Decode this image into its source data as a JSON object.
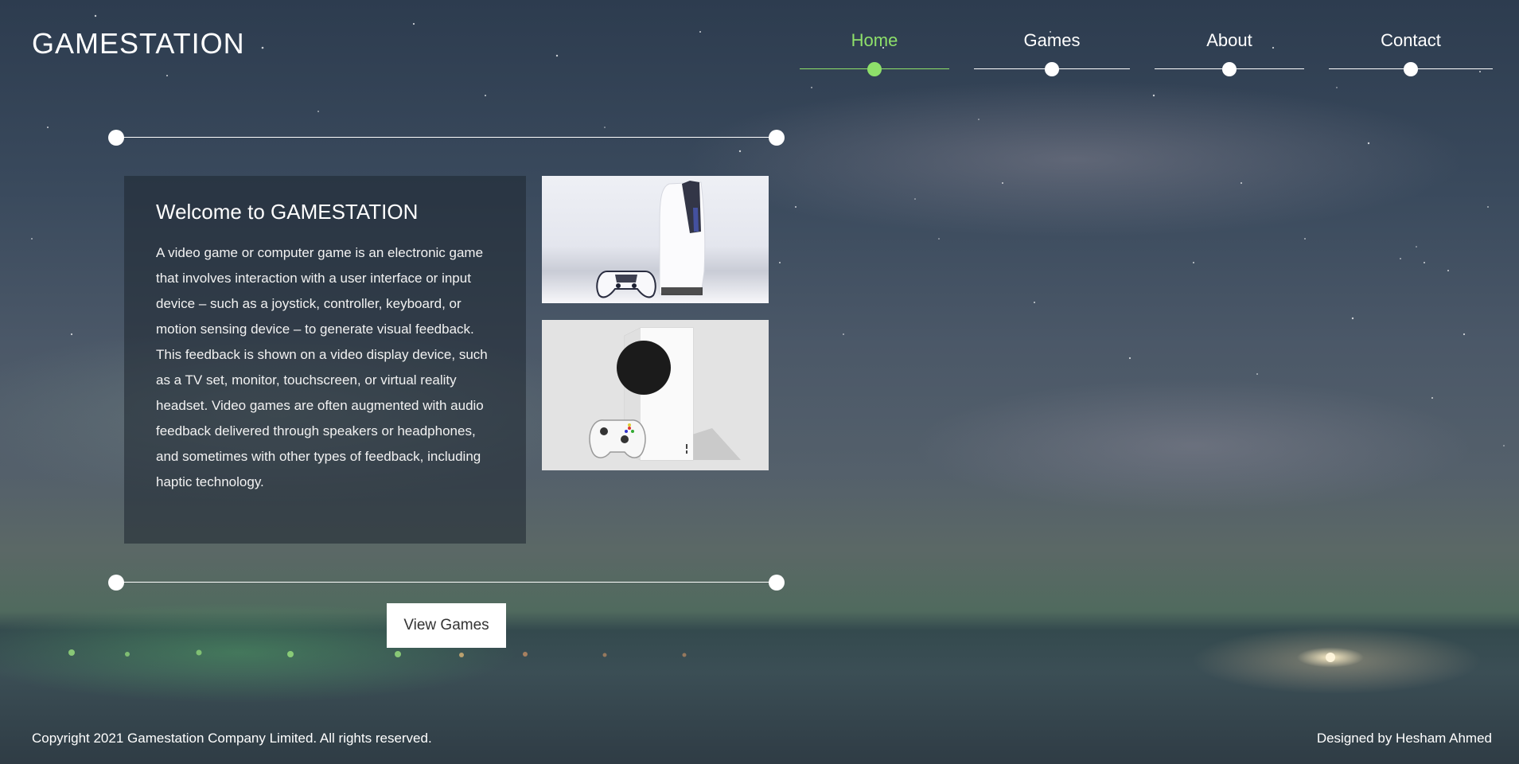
{
  "brand": {
    "logo_text": "GAMESTATION"
  },
  "nav": {
    "items": [
      {
        "label": "Home",
        "active": true
      },
      {
        "label": "Games",
        "active": false
      },
      {
        "label": "About",
        "active": false
      },
      {
        "label": "Contact",
        "active": false
      }
    ],
    "active_color": "#8ee06a"
  },
  "welcome": {
    "title": "Welcome to GAMESTATION",
    "body": "A video game or computer game is an electronic game that involves interaction with a user interface or input device – such as a joystick, controller, keyboard, or motion sensing device – to generate visual feedback. This feedback is shown on a video display device, such as a TV set, monitor, touchscreen, or virtual reality headset. Video games are often augmented with audio feedback delivered through speakers or headphones, and sometimes with other types of feedback, including haptic technology."
  },
  "images": {
    "console_1": "playstation-5-console-image",
    "console_2": "xbox-series-s-console-image"
  },
  "cta": {
    "label": "View Games"
  },
  "footer": {
    "copyright": "Copyright 2021 Gamestation Company Limited. All rights reserved.",
    "credit": "Designed by Hesham Ahmed"
  }
}
